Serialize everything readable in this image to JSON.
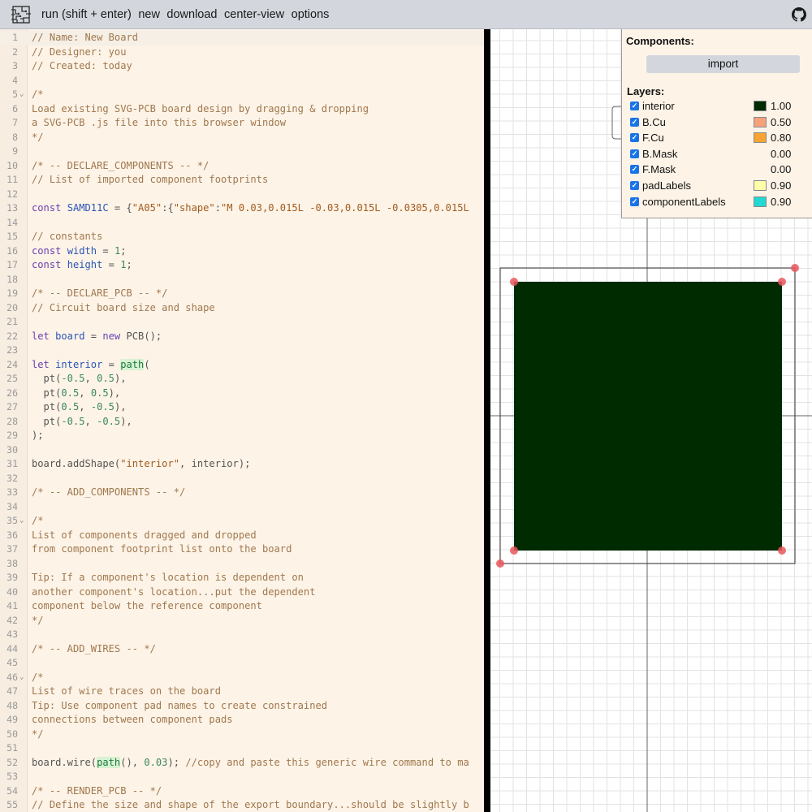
{
  "toolbar": {
    "menu": [
      "run (shift + enter)",
      "new",
      "download",
      "center-view",
      "options"
    ]
  },
  "editor": {
    "lines": [
      {
        "n": "1",
        "t": [
          [
            "c",
            "// Name: New Board"
          ]
        ]
      },
      {
        "n": "2",
        "t": [
          [
            "c",
            "// Designer: you"
          ]
        ]
      },
      {
        "n": "3",
        "t": [
          [
            "c",
            "// Created: today"
          ]
        ]
      },
      {
        "n": "4",
        "t": []
      },
      {
        "n": "5",
        "fold": true,
        "t": [
          [
            "c",
            "/*"
          ]
        ]
      },
      {
        "n": "6",
        "t": [
          [
            "c",
            "Load existing SVG-PCB board design by dragging & dropping"
          ]
        ]
      },
      {
        "n": "7",
        "t": [
          [
            "c",
            "a SVG-PCB .js file into this browser window"
          ]
        ]
      },
      {
        "n": "8",
        "t": [
          [
            "c",
            "*/"
          ]
        ]
      },
      {
        "n": "9",
        "t": []
      },
      {
        "n": "10",
        "t": [
          [
            "c",
            "/* -- DECLARE_COMPONENTS -- */"
          ]
        ]
      },
      {
        "n": "11",
        "t": [
          [
            "c",
            "// List of imported component footprints"
          ]
        ]
      },
      {
        "n": "12",
        "t": []
      },
      {
        "n": "13",
        "t": [
          [
            "k",
            "const "
          ],
          [
            "v",
            "SAMD11C"
          ],
          [
            "p",
            " = {"
          ],
          [
            "s",
            "\"A05\""
          ],
          [
            "p",
            ":{"
          ],
          [
            "s",
            "\"shape\""
          ],
          [
            "p",
            ":"
          ],
          [
            "s",
            "\"M 0.03,0.015L -0.03,0.015L -0.0305,0.015L"
          ]
        ]
      },
      {
        "n": "14",
        "t": []
      },
      {
        "n": "15",
        "t": [
          [
            "c",
            "// constants"
          ]
        ]
      },
      {
        "n": "16",
        "t": [
          [
            "k",
            "const "
          ],
          [
            "v",
            "width"
          ],
          [
            "p",
            " = "
          ],
          [
            "n",
            "1"
          ],
          [
            "p",
            ";"
          ]
        ]
      },
      {
        "n": "17",
        "t": [
          [
            "k",
            "const "
          ],
          [
            "v",
            "height"
          ],
          [
            "p",
            " = "
          ],
          [
            "n",
            "1"
          ],
          [
            "p",
            ";"
          ]
        ]
      },
      {
        "n": "18",
        "t": []
      },
      {
        "n": "19",
        "t": [
          [
            "c",
            "/* -- DECLARE_PCB -- */"
          ]
        ]
      },
      {
        "n": "20",
        "t": [
          [
            "c",
            "// Circuit board size and shape"
          ]
        ]
      },
      {
        "n": "21",
        "t": []
      },
      {
        "n": "22",
        "t": [
          [
            "k",
            "let "
          ],
          [
            "v",
            "board"
          ],
          [
            "p",
            " = "
          ],
          [
            "k",
            "new "
          ],
          [
            "p",
            "PCB();"
          ]
        ]
      },
      {
        "n": "23",
        "t": []
      },
      {
        "n": "24",
        "t": [
          [
            "k",
            "let "
          ],
          [
            "v",
            "interior"
          ],
          [
            "p",
            " = "
          ],
          [
            "h",
            "path"
          ],
          [
            "p",
            "("
          ]
        ]
      },
      {
        "n": "25",
        "t": [
          [
            "p",
            "  pt("
          ],
          [
            "n",
            "-0.5"
          ],
          [
            "p",
            ", "
          ],
          [
            "n",
            "0.5"
          ],
          [
            "p",
            "),"
          ]
        ]
      },
      {
        "n": "26",
        "t": [
          [
            "p",
            "  pt("
          ],
          [
            "n",
            "0.5"
          ],
          [
            "p",
            ", "
          ],
          [
            "n",
            "0.5"
          ],
          [
            "p",
            "),"
          ]
        ]
      },
      {
        "n": "27",
        "t": [
          [
            "p",
            "  pt("
          ],
          [
            "n",
            "0.5"
          ],
          [
            "p",
            ", "
          ],
          [
            "n",
            "-0.5"
          ],
          [
            "p",
            "),"
          ]
        ]
      },
      {
        "n": "28",
        "t": [
          [
            "p",
            "  pt("
          ],
          [
            "n",
            "-0.5"
          ],
          [
            "p",
            ", "
          ],
          [
            "n",
            "-0.5"
          ],
          [
            "p",
            "),"
          ]
        ]
      },
      {
        "n": "29",
        "t": [
          [
            "p",
            ");"
          ]
        ]
      },
      {
        "n": "30",
        "t": []
      },
      {
        "n": "31",
        "t": [
          [
            "p",
            "board.addShape("
          ],
          [
            "s",
            "\"interior\""
          ],
          [
            "p",
            ", interior);"
          ]
        ]
      },
      {
        "n": "32",
        "t": []
      },
      {
        "n": "33",
        "t": [
          [
            "c",
            "/* -- ADD_COMPONENTS -- */"
          ]
        ]
      },
      {
        "n": "34",
        "t": []
      },
      {
        "n": "35",
        "fold": true,
        "t": [
          [
            "c",
            "/*"
          ]
        ]
      },
      {
        "n": "36",
        "t": [
          [
            "c",
            "List of components dragged and dropped"
          ]
        ]
      },
      {
        "n": "37",
        "t": [
          [
            "c",
            "from component footprint list onto the board"
          ]
        ]
      },
      {
        "n": "38",
        "t": []
      },
      {
        "n": "39",
        "t": [
          [
            "c",
            "Tip: If a component's location is dependent on"
          ]
        ]
      },
      {
        "n": "40",
        "t": [
          [
            "c",
            "another component's location...put the dependent"
          ]
        ]
      },
      {
        "n": "41",
        "t": [
          [
            "c",
            "component below the reference component"
          ]
        ]
      },
      {
        "n": "42",
        "t": [
          [
            "c",
            "*/"
          ]
        ]
      },
      {
        "n": "43",
        "t": []
      },
      {
        "n": "44",
        "t": [
          [
            "c",
            "/* -- ADD_WIRES -- */"
          ]
        ]
      },
      {
        "n": "45",
        "t": []
      },
      {
        "n": "46",
        "fold": true,
        "t": [
          [
            "c",
            "/*"
          ]
        ]
      },
      {
        "n": "47",
        "t": [
          [
            "c",
            "List of wire traces on the board"
          ]
        ]
      },
      {
        "n": "48",
        "t": [
          [
            "c",
            "Tip: Use component pad names to create constrained"
          ]
        ]
      },
      {
        "n": "49",
        "t": [
          [
            "c",
            "connections between component pads"
          ]
        ]
      },
      {
        "n": "50",
        "t": [
          [
            "c",
            "*/"
          ]
        ]
      },
      {
        "n": "51",
        "t": []
      },
      {
        "n": "52",
        "t": [
          [
            "p",
            "board.wire("
          ],
          [
            "h",
            "path"
          ],
          [
            "p",
            "(), "
          ],
          [
            "n",
            "0.03"
          ],
          [
            "p",
            "); "
          ],
          [
            "c",
            "//copy and paste this generic wire command to ma"
          ]
        ]
      },
      {
        "n": "53",
        "t": []
      },
      {
        "n": "54",
        "t": [
          [
            "c",
            "/* -- RENDER_PCB -- */"
          ]
        ]
      },
      {
        "n": "55",
        "t": [
          [
            "c",
            "// Define the size and shape of the export boundary...should be slightly b"
          ]
        ]
      }
    ]
  },
  "panel": {
    "components_heading": "Components:",
    "import_label": "import",
    "layers_heading": "Layers:",
    "layers": [
      {
        "name": "interior",
        "value": "1.00",
        "color": "#002a00",
        "checked": true
      },
      {
        "name": "B.Cu",
        "value": "0.50",
        "color": "#f5a17b",
        "checked": true
      },
      {
        "name": "F.Cu",
        "value": "0.80",
        "color": "#f7a435",
        "checked": true
      },
      {
        "name": "B.Mask",
        "value": "0.00",
        "color": null,
        "checked": true
      },
      {
        "name": "F.Mask",
        "value": "0.00",
        "color": null,
        "checked": true
      },
      {
        "name": "padLabels",
        "value": "0.90",
        "color": "#ffffaa",
        "checked": true
      },
      {
        "name": "componentLabels",
        "value": "0.90",
        "color": "#22d8d3",
        "checked": true
      }
    ]
  },
  "viewer": {
    "board_color": "#002a00",
    "handle_color": "#e8575a"
  }
}
